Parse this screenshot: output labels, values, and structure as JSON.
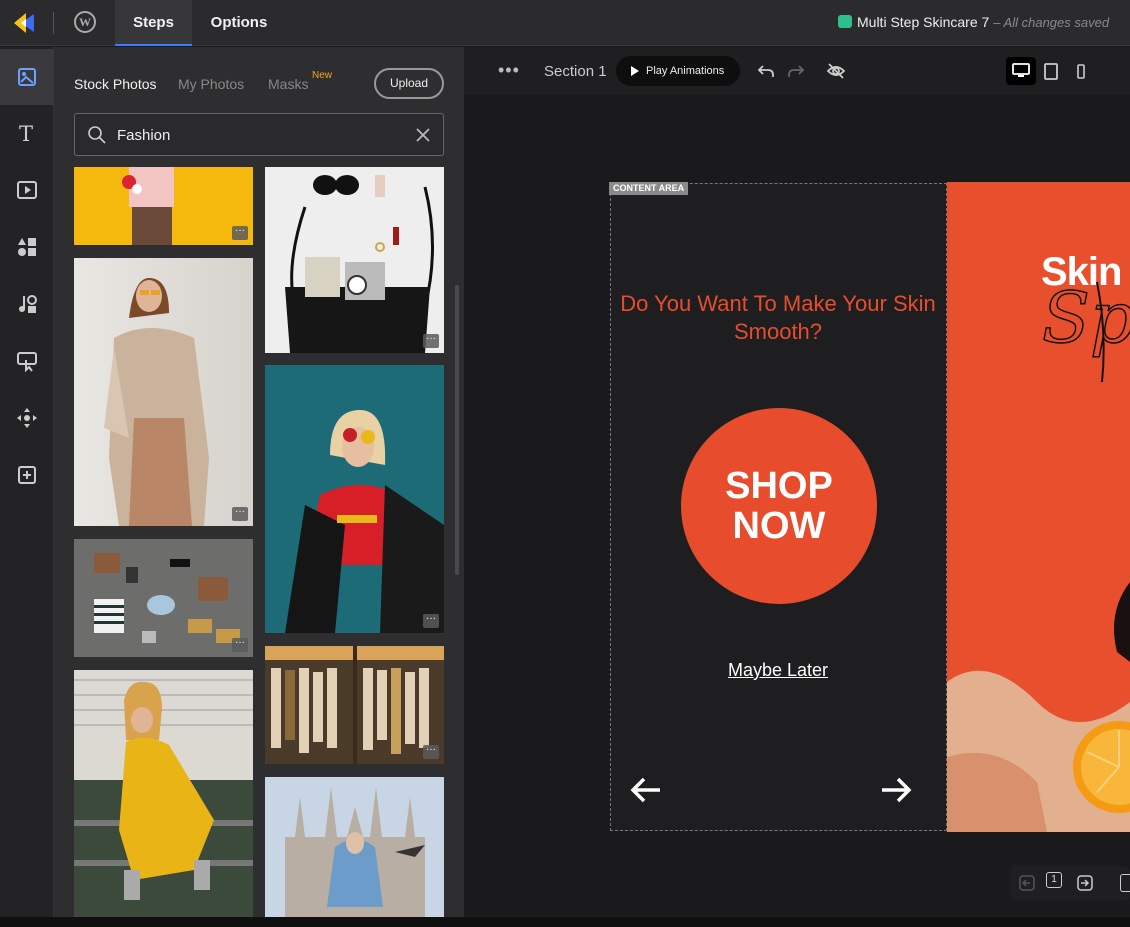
{
  "topbar": {
    "tabs": [
      {
        "label": "Steps"
      },
      {
        "label": "Options"
      }
    ],
    "project_name": "Multi Step Skincare 7",
    "save_status": "– All changes saved"
  },
  "panel": {
    "tabs": [
      {
        "label": "Stock Photos"
      },
      {
        "label": "My Photos"
      },
      {
        "label": "Masks"
      }
    ],
    "new_badge": "New",
    "upload_label": "Upload",
    "search_value": "Fashion"
  },
  "toolbar": {
    "section_label": "Section 1",
    "play_label": "Play Animations"
  },
  "canvas": {
    "content_area_label": "CONTENT AREA",
    "headline": "Do You Want To Make Your Skin Smooth?",
    "cta_line1": "SHOP",
    "cta_line2": "NOW",
    "secondary_link": "Maybe Later",
    "right_panel_word": "Skin",
    "right_panel_script": "Sp"
  },
  "pager": {
    "page_number": "1"
  },
  "colors": {
    "accent": "#e74c2c",
    "tab_underline": "#3d7cff",
    "saved_icon": "#2fbf8c"
  }
}
